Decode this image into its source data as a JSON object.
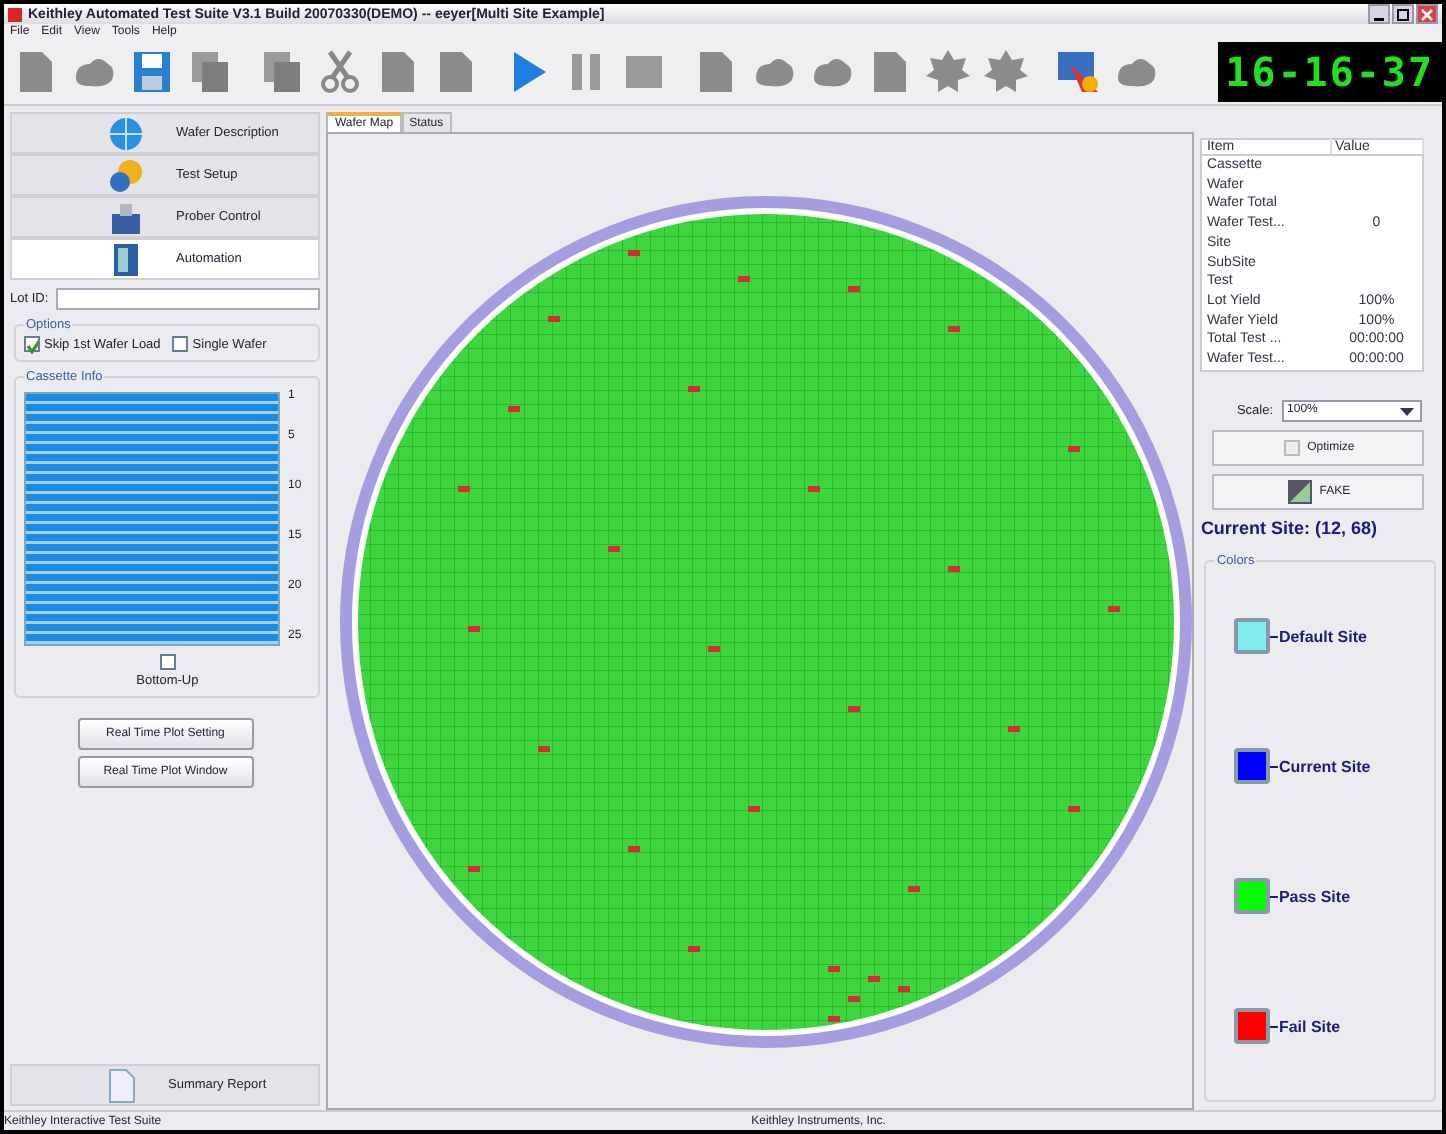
{
  "window": {
    "title": "Keithley Automated Test Suite V3.1 Build 20070330(DEMO) -- eeyer[Multi Site Example]"
  },
  "menu": [
    "File",
    "Edit",
    "View",
    "Tools",
    "Help"
  ],
  "clock": "16-16-37",
  "nav": [
    {
      "label": "Wafer Description",
      "selected": false,
      "kind": "globe"
    },
    {
      "label": "Test Setup",
      "selected": false,
      "kind": "gears"
    },
    {
      "label": "Prober Control",
      "selected": false,
      "kind": "prober"
    },
    {
      "label": "Automation",
      "selected": true,
      "kind": "cabinet"
    }
  ],
  "lot_id": {
    "label": "Lot ID:"
  },
  "options": {
    "title": "Options",
    "checkboxes": [
      {
        "label": "Skip 1st Wafer Load",
        "checked": true
      },
      {
        "label": "Single Wafer",
        "checked": false
      }
    ]
  },
  "cassette": {
    "title": "Cassette Info",
    "slot_labels": [
      "1",
      "5",
      "10",
      "15",
      "20",
      "25"
    ],
    "bottom_up": {
      "label": "Bottom-Up",
      "checked": false
    }
  },
  "buttons": [
    "Real Time Plot Setting",
    "Real Time Plot Window"
  ],
  "summary": {
    "label": "Summary Report"
  },
  "tabs": [
    {
      "label": "Wafer Map",
      "selected": true
    },
    {
      "label": "Status",
      "selected": false
    }
  ],
  "table": {
    "columns": [
      "Item",
      "Value"
    ],
    "rows": [
      {
        "item": "Cassette"
      },
      {
        "item": "Wafer"
      },
      {
        "item": "Wafer Total"
      },
      {
        "item": "Wafer Test...",
        "value": "0"
      },
      {
        "item": "Site"
      },
      {
        "item": "SubSite"
      },
      {
        "item": "Test"
      },
      {
        "item": "Lot Yield",
        "value": "100%"
      },
      {
        "item": "Wafer Yield",
        "value": "100%"
      },
      {
        "item": "Total Test ...",
        "value": "00:00:00"
      },
      {
        "item": "Wafer Test...",
        "value": "00:00:00"
      }
    ]
  },
  "scale": {
    "label": "Scale:",
    "value": "100%"
  },
  "optimize": "Optimize",
  "fake": "FAKE",
  "current_site": "Current Site: (12, 68)",
  "colors": {
    "title": "Colors",
    "items": [
      {
        "label": "Default Site",
        "color": "#80eeee"
      },
      {
        "label": "Current Site",
        "color": "#0000ff"
      },
      {
        "label": "Pass Site",
        "color": "#00ff00"
      },
      {
        "label": "Fail Site",
        "color": "#ff0000"
      }
    ]
  },
  "status_bar": [
    "Keithley Interactive Test Suite",
    "Keithley Instruments, Inc."
  ]
}
